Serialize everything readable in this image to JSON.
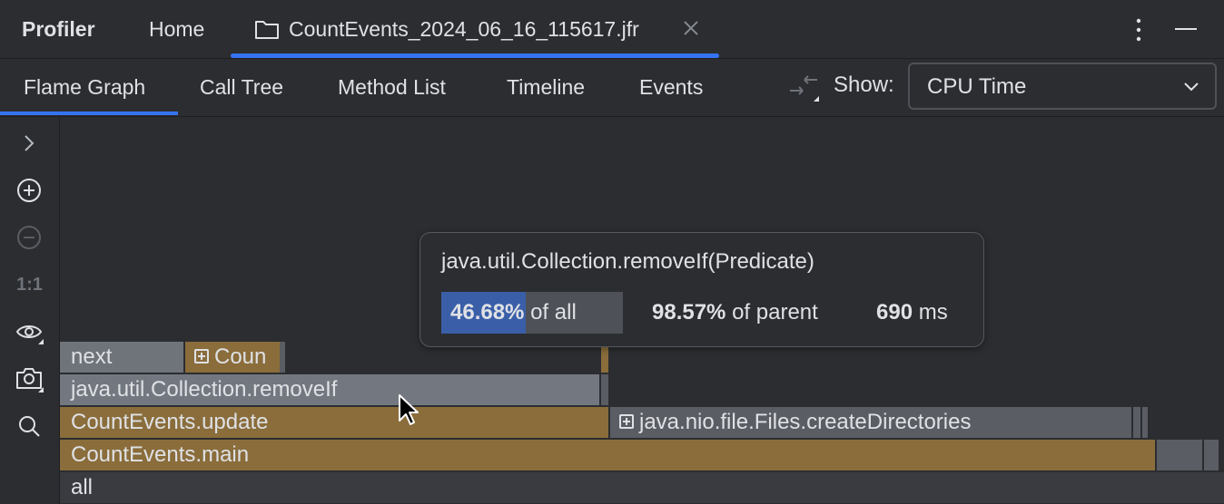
{
  "header": {
    "app_title": "Profiler",
    "home_tab": "Home",
    "file_tab": {
      "label": "CountEvents_2024_06_16_115617.jfr",
      "icon": "folder-icon"
    }
  },
  "toolbar": {
    "tabs": [
      "Flame Graph",
      "Call Tree",
      "Method List",
      "Timeline",
      "Events"
    ],
    "active_tab": "Flame Graph",
    "show_label": "Show:",
    "show_value": "CPU Time"
  },
  "sidebar": {
    "icons": [
      "chevron-right-icon",
      "zoom-in-icon",
      "zoom-out-icon",
      "reset-zoom",
      "eye-icon",
      "camera-icon",
      "search-icon"
    ],
    "reset_label": "1:1"
  },
  "flame": {
    "rows": {
      "next": "next",
      "coun": "Coun",
      "removeif": "java.util.Collection.removeIf",
      "update": "CountEvents.update",
      "create_dirs": "java.nio.file.Files.createDirectories",
      "main": "CountEvents.main",
      "all": "all"
    }
  },
  "tooltip": {
    "method": "java.util.Collection.removeIf(Predicate)",
    "of_all_value": "46.68%",
    "of_all_label": "of all",
    "of_all_fraction": 0.4668,
    "of_parent_value": "98.57%",
    "of_parent_label": "of parent",
    "time_value": "690",
    "time_unit": "ms"
  },
  "colors": {
    "accent": "#3574f0",
    "frame_gray": "#6f737a",
    "frame_brown": "#8a6d3b",
    "background": "#2b2d30"
  }
}
